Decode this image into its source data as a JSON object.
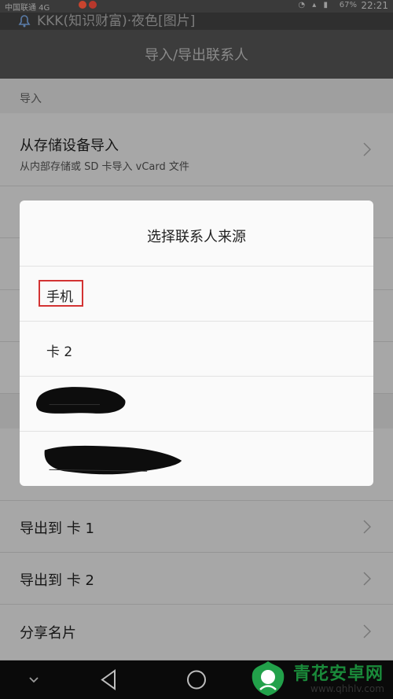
{
  "status_bar": {
    "carrier": "中国联通 4G",
    "battery": "67%",
    "time": "22:21"
  },
  "notification": {
    "text": "KKK(知识财富)·夜色[图片]"
  },
  "titlebar": {
    "title": "导入/导出联系人"
  },
  "content": {
    "import_section": "导入",
    "import_storage_title": "从存储设备导入",
    "import_storage_sub": "从内部存储或 SD 卡导入 vCard 文件",
    "export_card1": "导出到 卡 1",
    "export_card2": "导出到 卡 2",
    "share_card": "分享名片"
  },
  "dialog": {
    "title": "选择联系人来源",
    "options": [
      "手机",
      "卡 2"
    ]
  },
  "colors": {
    "highlight": "#d33333",
    "brand": "#1a8a3a"
  },
  "watermark": {
    "brand": "青花安卓网",
    "url": "www.qhhlv.com"
  }
}
